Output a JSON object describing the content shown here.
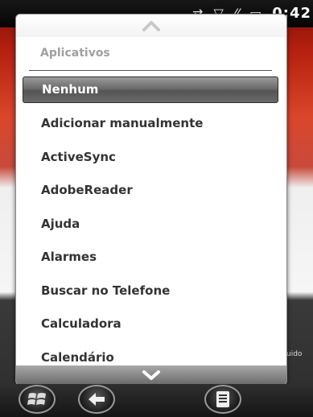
{
  "status": {
    "time": "0:42"
  },
  "popup": {
    "header": "Aplicativos",
    "items": [
      {
        "label": "Nenhum",
        "selected": true
      },
      {
        "label": "Adicionar manualmente"
      },
      {
        "label": "ActiveSync"
      },
      {
        "label": "AdobeReader"
      },
      {
        "label": "Ajuda"
      },
      {
        "label": "Alarmes"
      },
      {
        "label": "Buscar no Telefone"
      },
      {
        "label": "Calculadora"
      },
      {
        "label": "Calendário"
      }
    ]
  },
  "background": {
    "partial_text": "uido"
  },
  "icons": {
    "scroll_up": "chevron-up-icon",
    "scroll_down": "chevron-down-icon",
    "start": "windows-start-icon",
    "back": "back-arrow-icon",
    "menu": "menu-icon"
  }
}
